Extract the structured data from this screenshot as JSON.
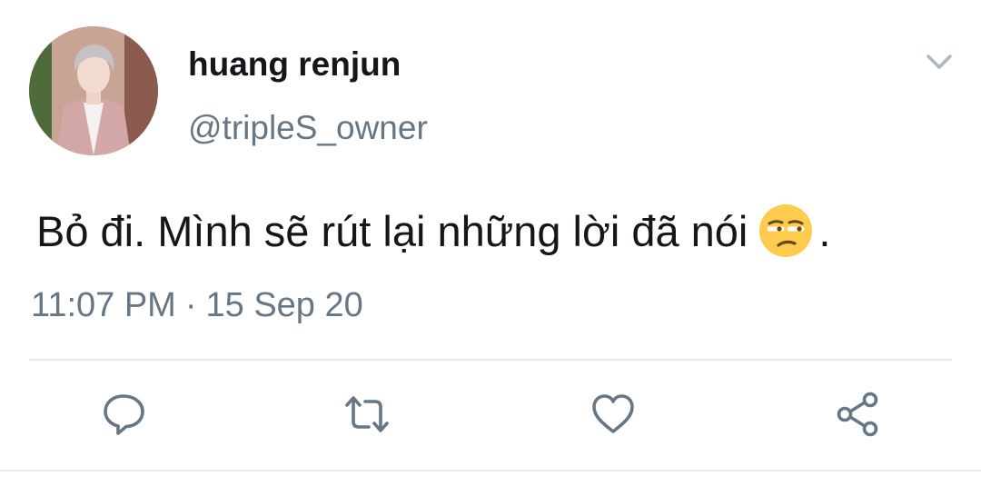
{
  "tweet": {
    "display_name": "huang renjun",
    "handle": "@tripleS_owner",
    "text": "Bỏ đi. Mình sẽ rút lại những lời đã nói",
    "text_suffix": ".",
    "emoji": "unamused-face",
    "time": "11:07 PM",
    "separator": "·",
    "date": "15 Sep 20"
  },
  "actions": [
    {
      "icon": "reply-icon"
    },
    {
      "icon": "retweet-icon"
    },
    {
      "icon": "like-icon"
    },
    {
      "icon": "share-icon"
    }
  ],
  "colors": {
    "text_primary": "#14171a",
    "text_secondary": "#657786",
    "icon": "#657786",
    "divider": "#e1e8ed",
    "emoji_face": "#ffcb4c"
  }
}
